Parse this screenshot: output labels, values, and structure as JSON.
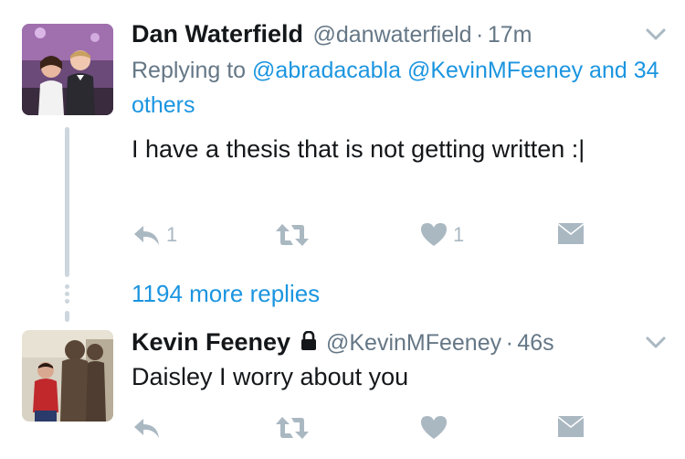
{
  "tweets": [
    {
      "name": "Dan Waterfield",
      "handle": "@danwaterfield",
      "dot": "·",
      "time": "17m",
      "reply_prefix": "Replying to ",
      "reply_links": "@abradacabla @KevinMFeeney and 34 others",
      "text": "I have a thesis that is not getting written :|",
      "reply_count": "1",
      "retweet_count": "",
      "like_count": "1",
      "icons": [
        "reply-icon",
        "retweet-icon",
        "heart-icon",
        "envelope-icon"
      ]
    },
    {
      "name": "Kevin Feeney",
      "handle": "@KevinMFeeney",
      "dot": "·",
      "time": "46s",
      "text": "Daisley I worry about you",
      "protected": true,
      "icons": [
        "reply-icon",
        "retweet-icon",
        "heart-icon",
        "envelope-icon"
      ]
    }
  ],
  "more_replies": "1194 more replies",
  "colors": {
    "link": "#1b95e0",
    "secondary": "#657786",
    "icon": "#aab8c2",
    "thread": "#ccd6dd"
  }
}
